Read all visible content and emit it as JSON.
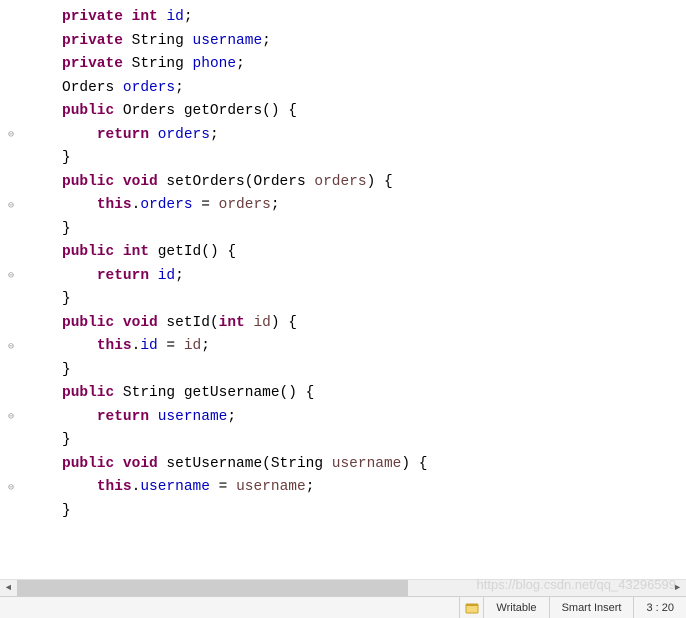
{
  "code": {
    "lines": [
      {
        "marker": "",
        "segs": [
          {
            "t": "private",
            "c": "kw"
          },
          {
            "t": " "
          },
          {
            "t": "int",
            "c": "kw"
          },
          {
            "t": " "
          },
          {
            "t": "id",
            "c": "fld"
          },
          {
            "t": ";"
          }
        ]
      },
      {
        "marker": "",
        "segs": [
          {
            "t": "private",
            "c": "kw"
          },
          {
            "t": " String "
          },
          {
            "t": "username",
            "c": "fld"
          },
          {
            "t": ";"
          }
        ]
      },
      {
        "marker": "",
        "segs": [
          {
            "t": "private",
            "c": "kw"
          },
          {
            "t": " String "
          },
          {
            "t": "phone",
            "c": "fld"
          },
          {
            "t": ";"
          }
        ]
      },
      {
        "marker": "",
        "segs": [
          {
            "t": "Orders "
          },
          {
            "t": "orders",
            "c": "fld"
          },
          {
            "t": ";"
          }
        ]
      },
      {
        "marker": "",
        "segs": [
          {
            "t": ""
          }
        ]
      },
      {
        "marker": "⊖",
        "segs": [
          {
            "t": "public",
            "c": "kw"
          },
          {
            "t": " Orders getOrders() {"
          }
        ]
      },
      {
        "marker": "",
        "indent": 1,
        "segs": [
          {
            "t": "return",
            "c": "kw"
          },
          {
            "t": " "
          },
          {
            "t": "orders",
            "c": "fld"
          },
          {
            "t": ";"
          }
        ]
      },
      {
        "marker": "",
        "segs": [
          {
            "t": "}"
          }
        ]
      },
      {
        "marker": "⊖",
        "segs": [
          {
            "t": "public",
            "c": "kw"
          },
          {
            "t": " "
          },
          {
            "t": "void",
            "c": "kw"
          },
          {
            "t": " setOrders(Orders "
          },
          {
            "t": "orders",
            "c": "var"
          },
          {
            "t": ") {"
          }
        ]
      },
      {
        "marker": "",
        "indent": 1,
        "segs": [
          {
            "t": "this",
            "c": "kw"
          },
          {
            "t": "."
          },
          {
            "t": "orders",
            "c": "fld"
          },
          {
            "t": " = "
          },
          {
            "t": "orders",
            "c": "var"
          },
          {
            "t": ";"
          }
        ]
      },
      {
        "marker": "",
        "segs": [
          {
            "t": "}"
          }
        ]
      },
      {
        "marker": "⊖",
        "segs": [
          {
            "t": "public",
            "c": "kw"
          },
          {
            "t": " "
          },
          {
            "t": "int",
            "c": "kw"
          },
          {
            "t": " getId() {"
          }
        ]
      },
      {
        "marker": "",
        "indent": 1,
        "segs": [
          {
            "t": "return",
            "c": "kw"
          },
          {
            "t": " "
          },
          {
            "t": "id",
            "c": "fld"
          },
          {
            "t": ";"
          }
        ]
      },
      {
        "marker": "",
        "segs": [
          {
            "t": "}"
          }
        ]
      },
      {
        "marker": "⊖",
        "segs": [
          {
            "t": "public",
            "c": "kw"
          },
          {
            "t": " "
          },
          {
            "t": "void",
            "c": "kw"
          },
          {
            "t": " setId("
          },
          {
            "t": "int",
            "c": "kw"
          },
          {
            "t": " "
          },
          {
            "t": "id",
            "c": "var"
          },
          {
            "t": ") {"
          }
        ]
      },
      {
        "marker": "",
        "indent": 1,
        "segs": [
          {
            "t": "this",
            "c": "kw"
          },
          {
            "t": "."
          },
          {
            "t": "id",
            "c": "fld"
          },
          {
            "t": " = "
          },
          {
            "t": "id",
            "c": "var"
          },
          {
            "t": ";"
          }
        ]
      },
      {
        "marker": "",
        "segs": [
          {
            "t": "}"
          }
        ]
      },
      {
        "marker": "⊖",
        "segs": [
          {
            "t": "public",
            "c": "kw"
          },
          {
            "t": " String getUsername() {"
          }
        ]
      },
      {
        "marker": "",
        "indent": 1,
        "segs": [
          {
            "t": "return",
            "c": "kw"
          },
          {
            "t": " "
          },
          {
            "t": "username",
            "c": "fld"
          },
          {
            "t": ";"
          }
        ]
      },
      {
        "marker": "",
        "segs": [
          {
            "t": "}"
          }
        ]
      },
      {
        "marker": "⊖",
        "segs": [
          {
            "t": "public",
            "c": "kw"
          },
          {
            "t": " "
          },
          {
            "t": "void",
            "c": "kw"
          },
          {
            "t": " setUsername(String "
          },
          {
            "t": "username",
            "c": "var"
          },
          {
            "t": ") {"
          }
        ]
      },
      {
        "marker": "",
        "indent": 1,
        "segs": [
          {
            "t": "this",
            "c": "kw"
          },
          {
            "t": "."
          },
          {
            "t": "username",
            "c": "fld"
          },
          {
            "t": " = "
          },
          {
            "t": "username",
            "c": "var"
          },
          {
            "t": ";"
          }
        ]
      },
      {
        "marker": "",
        "segs": [
          {
            "t": "}"
          }
        ]
      }
    ]
  },
  "status": {
    "writable": "Writable",
    "insert_mode": "Smart Insert",
    "cursor": "3 : 20"
  },
  "scrollbar": {
    "left_arrow": "◄",
    "right_arrow": "►"
  },
  "watermark": "https://blog.csdn.net/qq_43296599"
}
